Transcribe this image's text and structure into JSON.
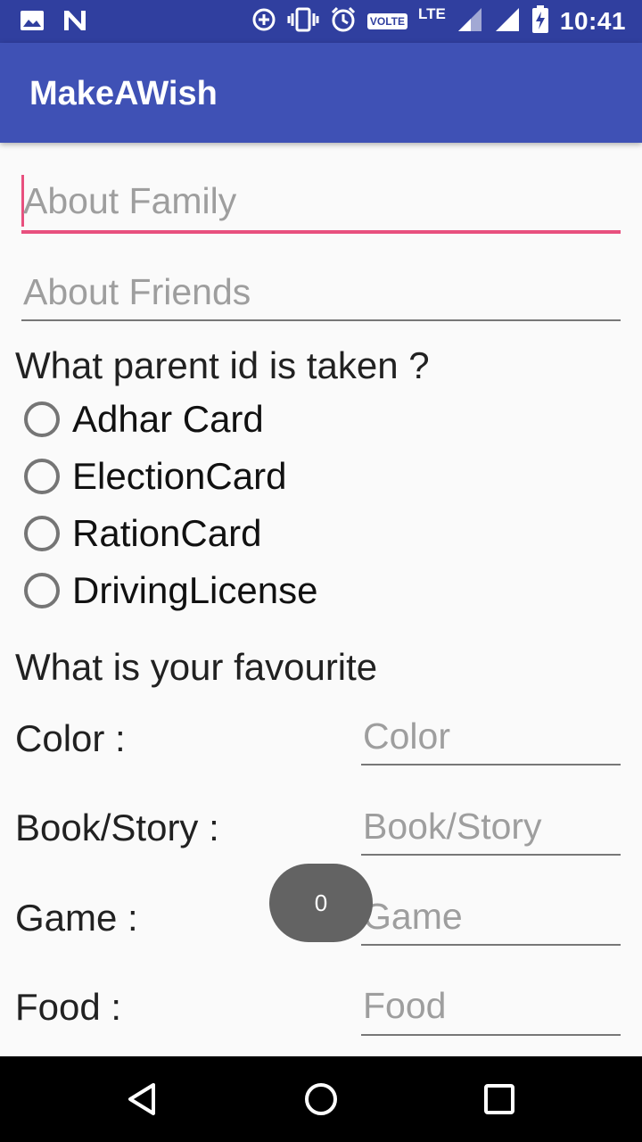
{
  "status_bar": {
    "time": "10:41",
    "volte": "VOLTE",
    "lte": "LTE",
    "icons": [
      "image-icon",
      "n-icon",
      "data-saver-icon",
      "vibrate-icon",
      "alarm-icon",
      "signal-icon",
      "battery-charging-icon"
    ]
  },
  "app": {
    "title": "MakeAWish"
  },
  "form": {
    "about_family_placeholder": "About Family",
    "about_friends_placeholder": "About Friends",
    "parent_id_question": "What parent id is taken ?",
    "parent_id_options": [
      "Adhar Card",
      "ElectionCard",
      "RationCard",
      "DrivingLicense"
    ],
    "favourite_heading": "What is your favourite",
    "favourites": [
      {
        "label": "Color :",
        "placeholder": "Color"
      },
      {
        "label": "Book/Story :",
        "placeholder": "Book/Story"
      },
      {
        "label": "Game :",
        "placeholder": "Game"
      },
      {
        "label": "Food :",
        "placeholder": "Food"
      }
    ]
  },
  "toast": {
    "text": "0"
  },
  "nav": {
    "icons": [
      "back-icon",
      "home-icon",
      "recents-icon"
    ]
  },
  "colors": {
    "status_bar": "#303f9f",
    "app_bar": "#3f51b5",
    "accent": "#e8507e"
  }
}
